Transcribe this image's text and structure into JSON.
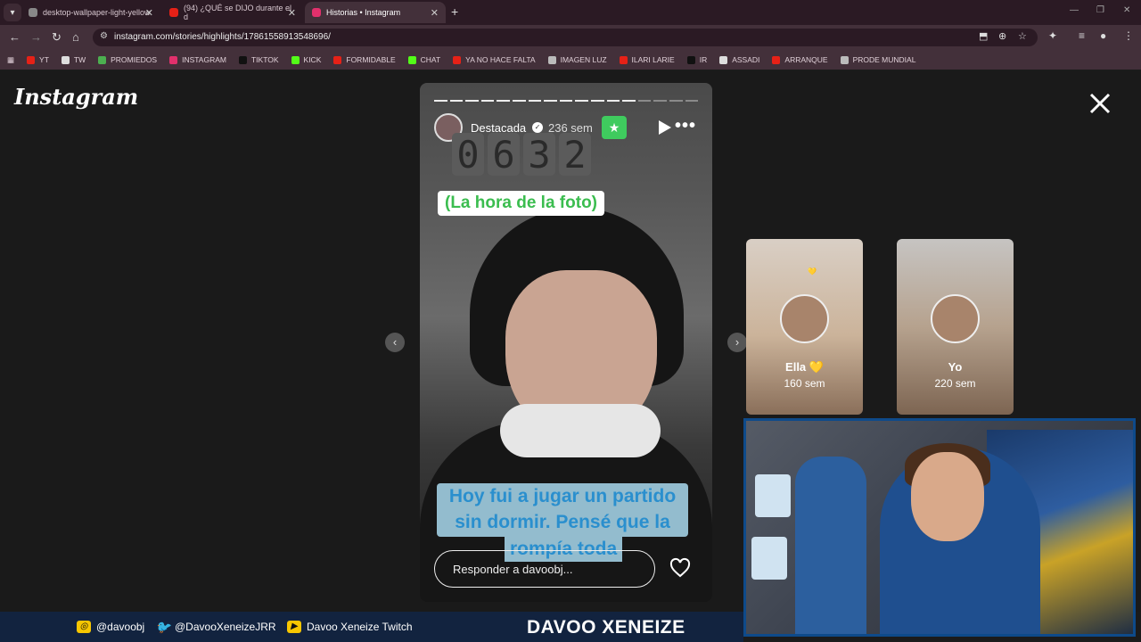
{
  "browser": {
    "tabs": [
      {
        "title": "desktop-wallpaper-light-yellow",
        "active": false
      },
      {
        "title": "(94) ¿QUÉ se DIJO durante el d",
        "active": false
      },
      {
        "title": "Historias • Instagram",
        "active": true
      }
    ],
    "url": "instagram.com/stories/highlights/17861558913548696/",
    "bookmarks": [
      "YT",
      "TW",
      "PROMIEDOS",
      "INSTAGRAM",
      "TIKTOK",
      "KICK",
      "FORMIDABLE",
      "CHAT",
      "YA NO HACE FALTA",
      "IMAGEN LUZ",
      "ILARI LARIE",
      "IR",
      "ASSADI",
      "ARRANQUE",
      "PRODE MUNDIAL"
    ]
  },
  "instagram": {
    "logo": "Instagram",
    "story": {
      "username": "Destacada",
      "time": "236 sem",
      "clock_digits": [
        "0",
        "6",
        "3",
        "2"
      ],
      "sticker_caption": "(La hora de la foto)",
      "text_line1": "Hoy fui a jugar un partido",
      "text_line2": "sin dormir. Pensé que la",
      "text_line3": "rompía toda",
      "reply_placeholder": "Responder a davoobj...",
      "progress_segments": 17,
      "progress_seen": 13
    },
    "side_stories": [
      {
        "name": "Ella 💛",
        "time": "160 sem"
      },
      {
        "name": "Yo",
        "time": "220 sem"
      }
    ]
  },
  "overlay": {
    "instagram_handle": "@davoobj",
    "twitter_handle": "@DavooXeneizeJRR",
    "twitch_handle": "Davoo Xeneize Twitch",
    "brand": "DAVOO XENEIZE"
  }
}
